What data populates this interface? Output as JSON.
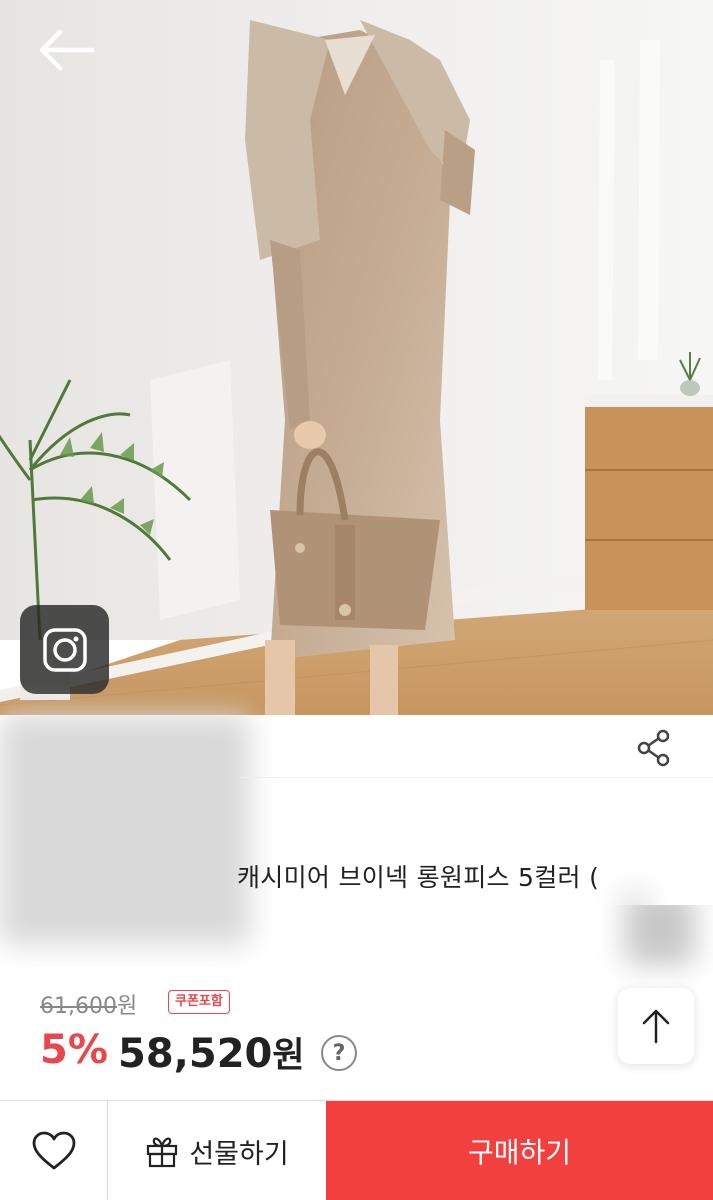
{
  "header": {
    "back_icon": "arrow-left-icon",
    "instagram_icon": "instagram-icon"
  },
  "product": {
    "title": "캐시미어 브이넥 롱원피스 5컬러 (",
    "share_icon": "share-icon"
  },
  "price": {
    "original": "61,600",
    "original_unit": "원",
    "coupon_badge": "쿠폰포함",
    "discount_rate": "5%",
    "sale": "58,520",
    "sale_unit": "원",
    "help_symbol": "?"
  },
  "scroll_top_icon": "arrow-up-icon",
  "actions": {
    "wishlist_icon": "heart-icon",
    "gift_icon": "gift-icon",
    "gift_label": "선물하기",
    "buy_label": "구매하기"
  },
  "colors": {
    "accent": "#f2403f",
    "discount": "#e8474b"
  }
}
